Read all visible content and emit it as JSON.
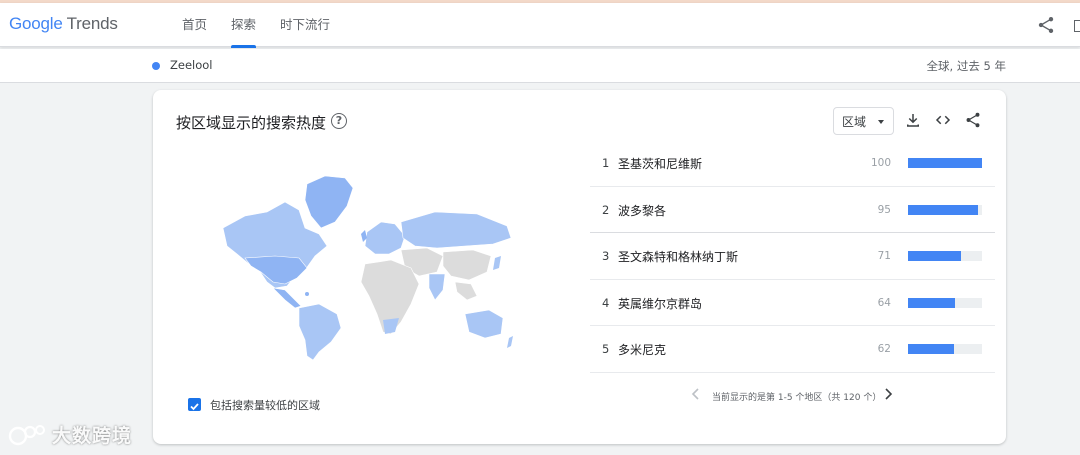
{
  "app": {
    "logo_google": "Google",
    "logo_trends": "Trends"
  },
  "nav": {
    "tabs": [
      {
        "label": "首页",
        "active": false
      },
      {
        "label": "探索",
        "active": true
      },
      {
        "label": "时下流行",
        "active": false
      }
    ]
  },
  "query": {
    "term": "Zeelool",
    "term_color": "#4285f4",
    "scope": "全球, 过去 5 年"
  },
  "card": {
    "title": "按区域显示的搜索热度",
    "region_select": "区域",
    "include_low_volume_label": "包括搜索量较低的区域",
    "include_low_volume_checked": true,
    "pagination": "当前显示的是第 1-5 个地区（共 120 个）"
  },
  "regions": [
    {
      "rank": "1",
      "name": "圣基茨和尼维斯",
      "value": 100
    },
    {
      "rank": "2",
      "name": "波多黎各",
      "value": 95
    },
    {
      "rank": "3",
      "name": "圣文森特和格林纳丁斯",
      "value": 71
    },
    {
      "rank": "4",
      "name": "英属维尔京群岛",
      "value": 64
    },
    {
      "rank": "5",
      "name": "多米尼克",
      "value": 62
    }
  ],
  "colors": {
    "accent": "#1a73e8",
    "bar": "#4285f4",
    "map_high": "#8fb4f3",
    "map_mid": "#a9c6f5",
    "map_none": "#dcdcdc"
  },
  "watermark": {
    "text": "大数跨境"
  }
}
